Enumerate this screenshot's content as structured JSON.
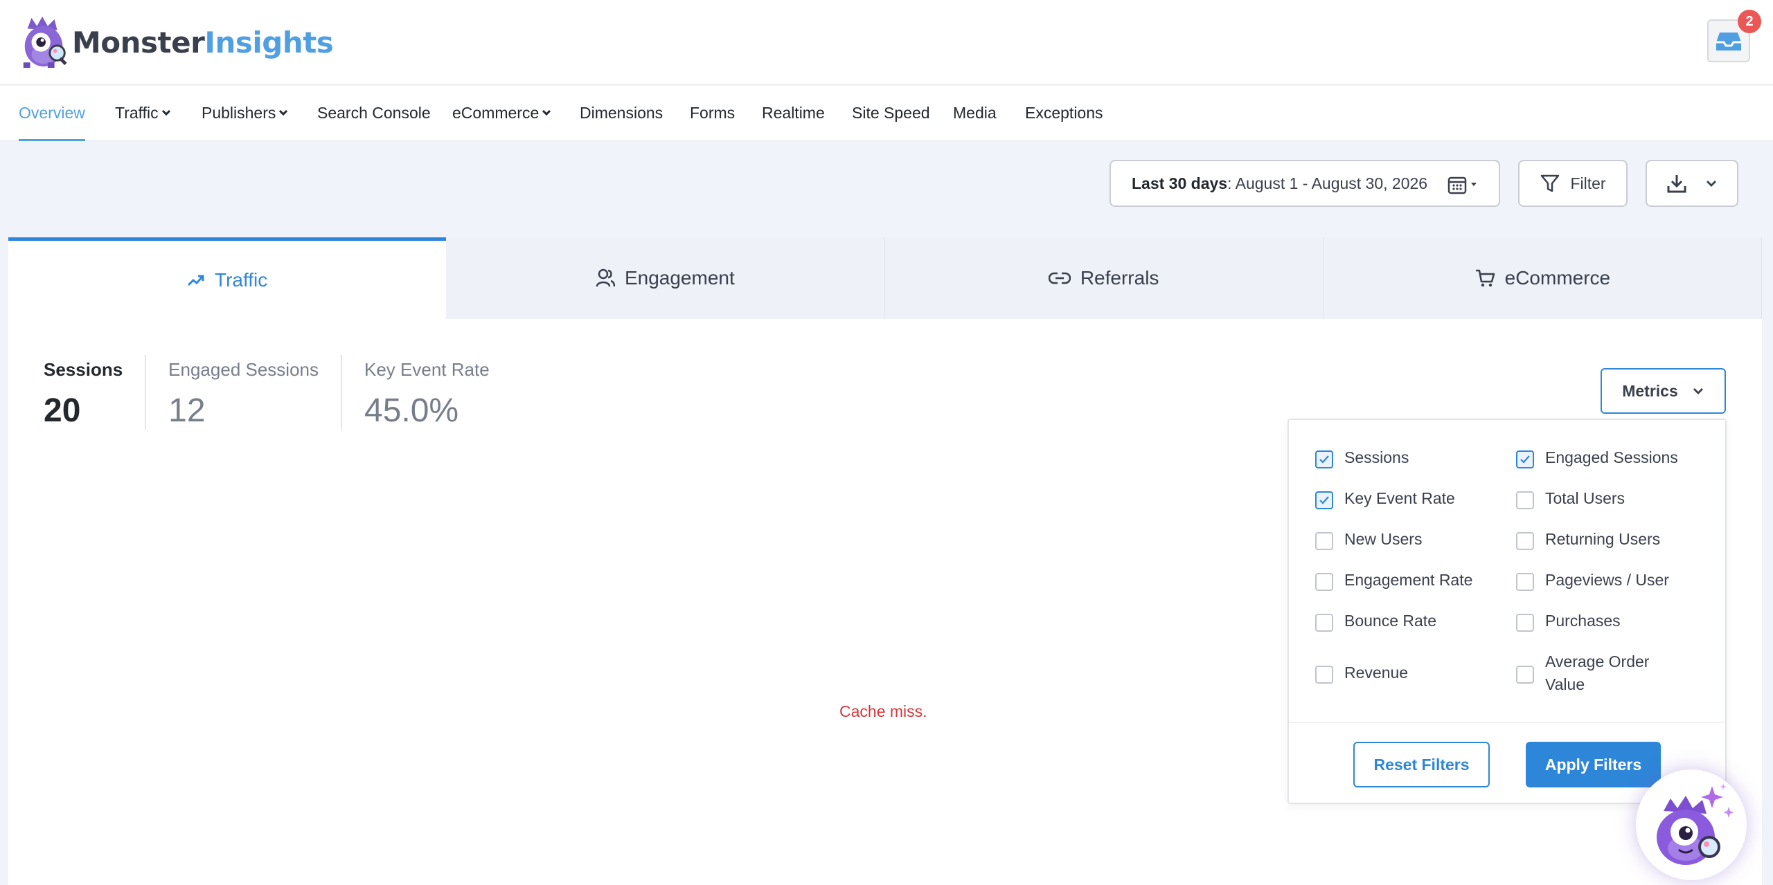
{
  "header": {
    "logo_part1": "Monster",
    "logo_part2": "Insights",
    "notification_count": "2"
  },
  "nav": {
    "items": [
      {
        "label": "Overview",
        "active": true
      },
      {
        "label": "Traffic",
        "dropdown": true
      },
      {
        "label": "Publishers",
        "dropdown": true
      },
      {
        "label": "Search Console"
      },
      {
        "label": "eCommerce",
        "dropdown": true
      },
      {
        "label": "Dimensions"
      },
      {
        "label": "Forms"
      },
      {
        "label": "Realtime"
      },
      {
        "label": "Site Speed"
      },
      {
        "label": "Media"
      },
      {
        "label": "Exceptions"
      }
    ]
  },
  "toolbar": {
    "date_range_label": "Last 30 days",
    "date_range_value": ": August 1 - August 30, 2026",
    "filter_label": "Filter"
  },
  "tabs": [
    {
      "label": "Traffic",
      "icon": "trend-up-icon",
      "active": true
    },
    {
      "label": "Engagement",
      "icon": "users-icon"
    },
    {
      "label": "Referrals",
      "icon": "link-icon"
    },
    {
      "label": "eCommerce",
      "icon": "cart-icon"
    }
  ],
  "stats": [
    {
      "label": "Sessions",
      "value": "20",
      "active": true
    },
    {
      "label": "Engaged Sessions",
      "value": "12"
    },
    {
      "label": "Key Event Rate",
      "value": "45.0%"
    }
  ],
  "chart_area": {
    "message": "Cache miss."
  },
  "metrics": {
    "button_label": "Metrics",
    "options": [
      {
        "label": "Sessions",
        "checked": true
      },
      {
        "label": "Engaged Sessions",
        "checked": true
      },
      {
        "label": "Key Event Rate",
        "checked": true
      },
      {
        "label": "Total Users",
        "checked": false
      },
      {
        "label": "New Users",
        "checked": false
      },
      {
        "label": "Returning Users",
        "checked": false
      },
      {
        "label": "Engagement Rate",
        "checked": false
      },
      {
        "label": "Pageviews / User",
        "checked": false
      },
      {
        "label": "Bounce Rate",
        "checked": false
      },
      {
        "label": "Purchases",
        "checked": false
      },
      {
        "label": "Revenue",
        "checked": false
      },
      {
        "label": "Average Order Value",
        "checked": false
      }
    ],
    "reset_label": "Reset Filters",
    "apply_label": "Apply Filters"
  },
  "colors": {
    "accent": "#2e86d9",
    "brand_blue": "#509fe2",
    "error": "#d63638",
    "badge": "#eb5757"
  }
}
